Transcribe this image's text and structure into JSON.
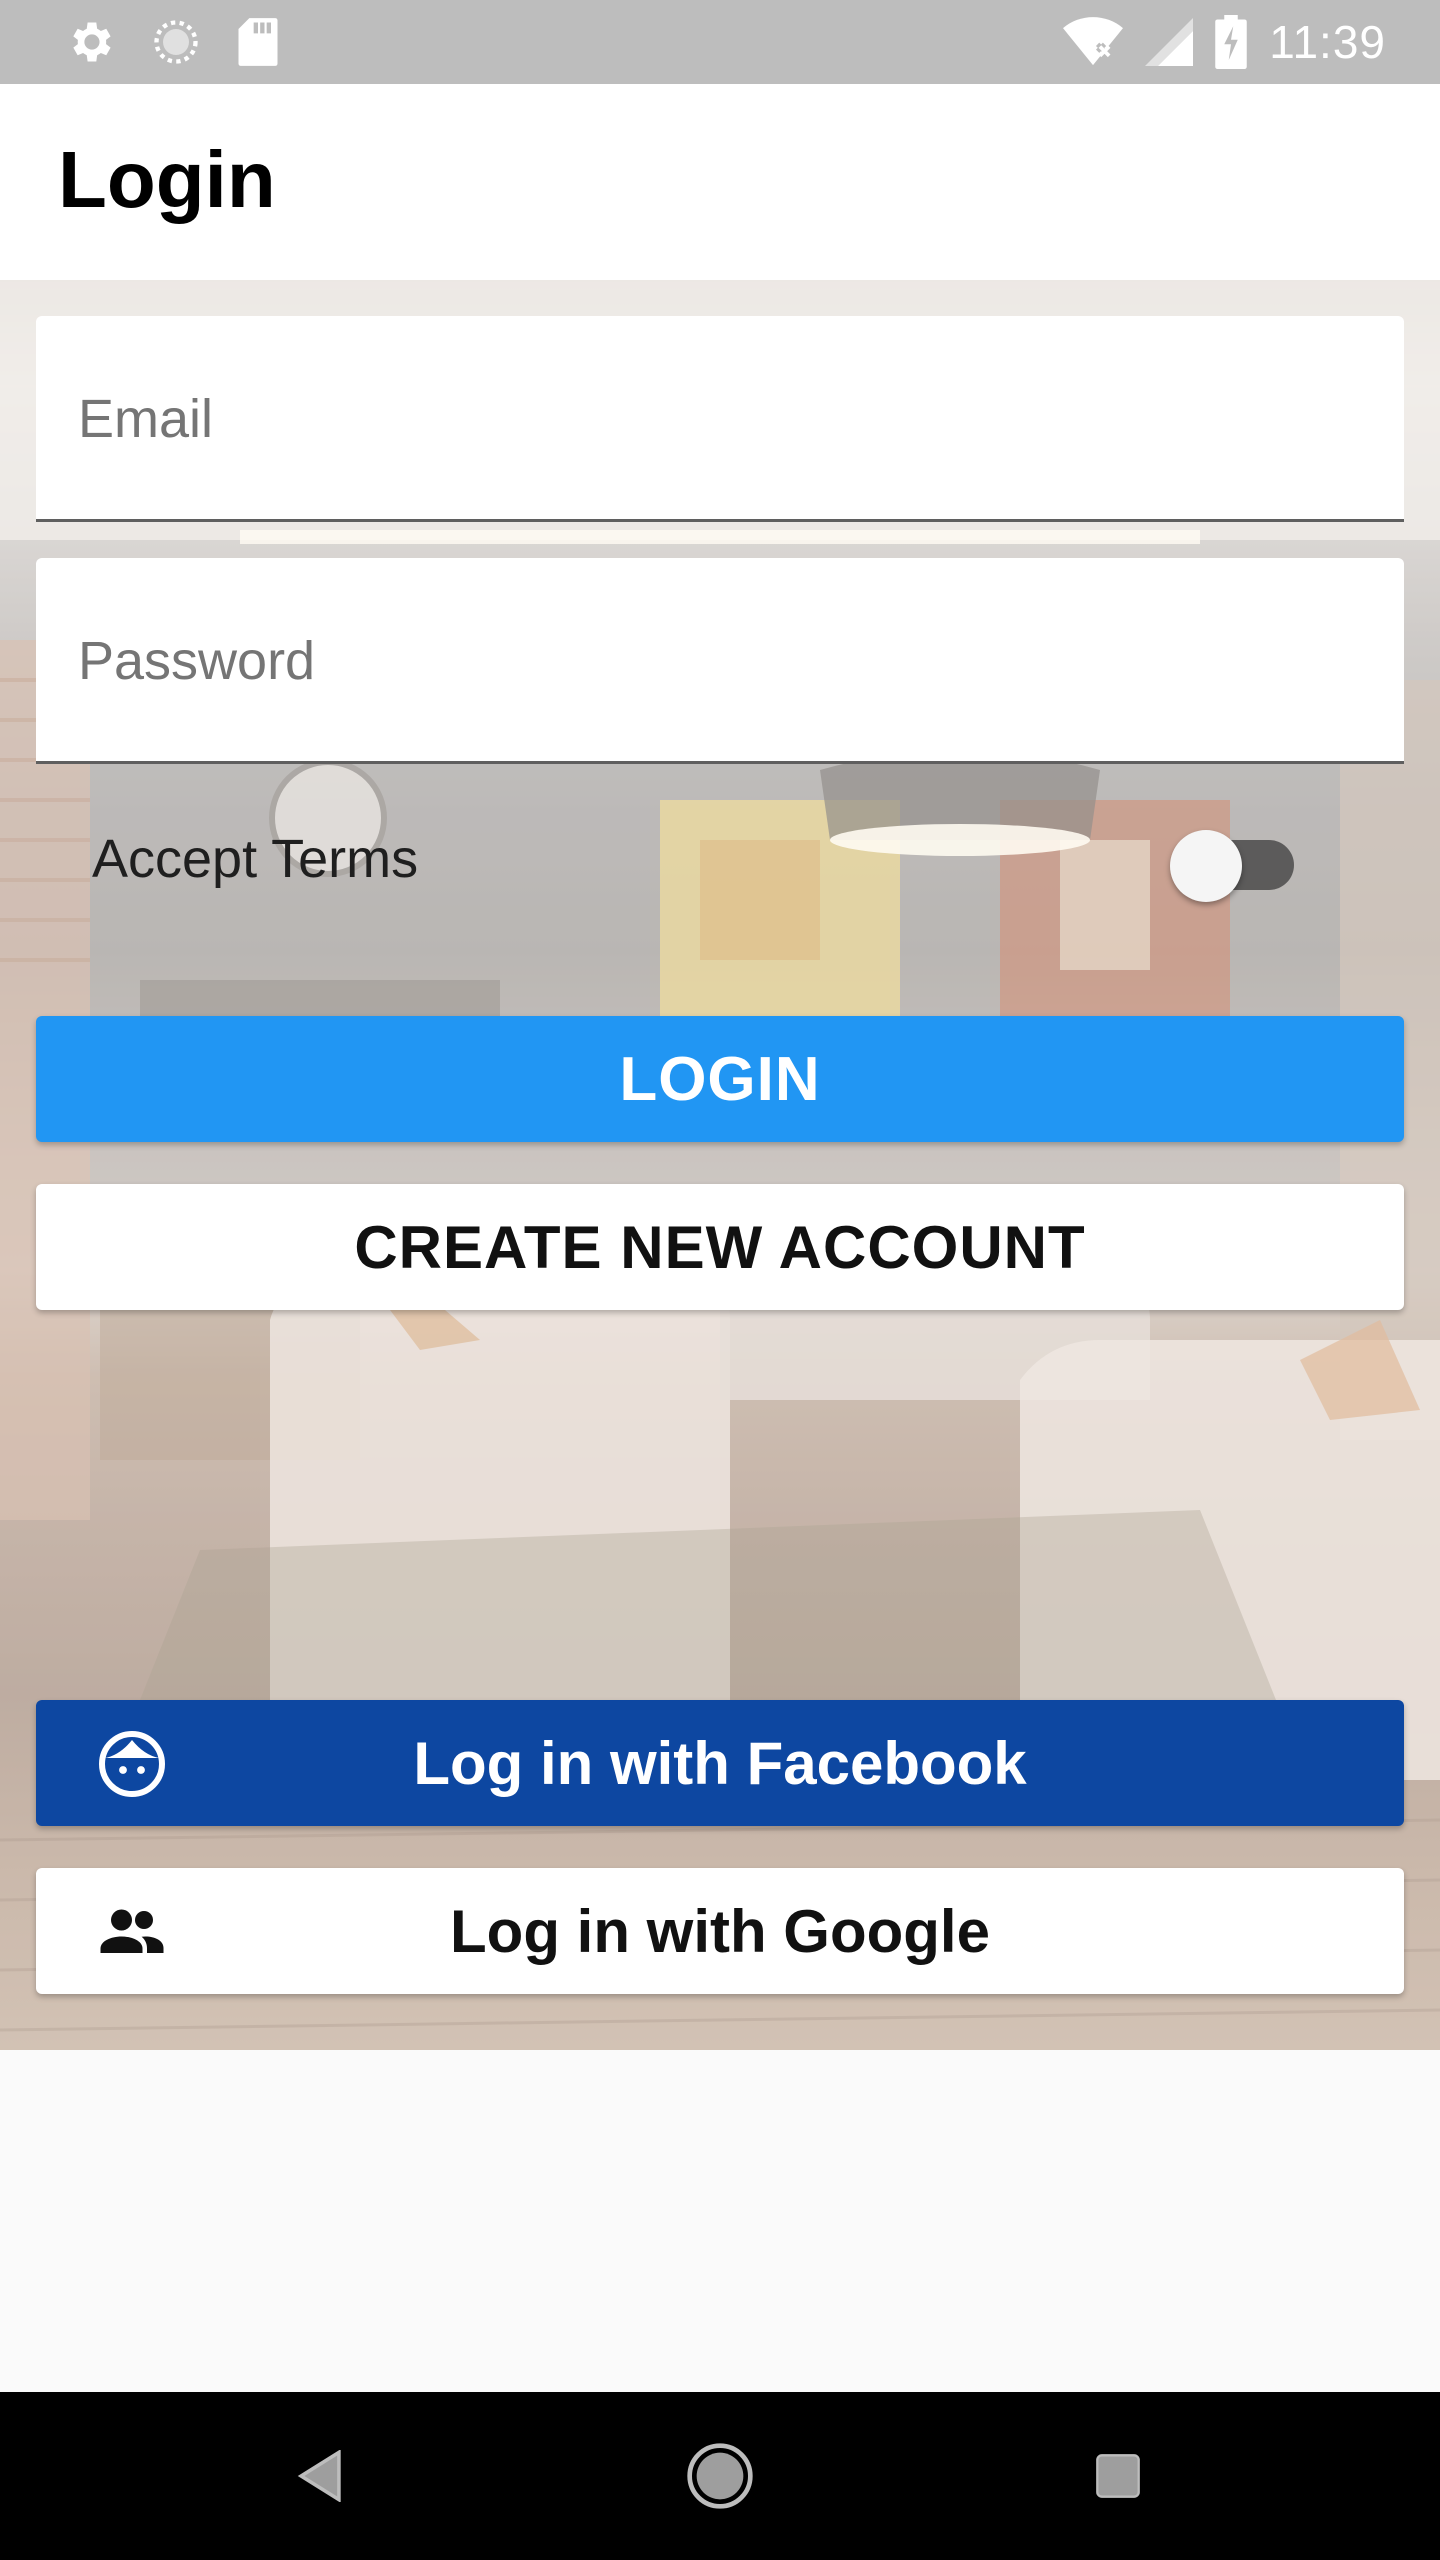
{
  "status_bar": {
    "time": "11:39",
    "left_icons": [
      "settings-icon",
      "sync-icon",
      "sd-card-icon"
    ],
    "right_icons": [
      "wifi-off-icon",
      "signal-icon",
      "battery-charging-icon"
    ],
    "background": "#bdbdbd"
  },
  "app_bar": {
    "title": "Login"
  },
  "form": {
    "email_placeholder": "Email",
    "email_value": "",
    "password_placeholder": "Password",
    "password_value": "",
    "terms_label": "Accept Terms",
    "terms_accepted": false
  },
  "buttons": {
    "login": "LOGIN",
    "create_account": "CREATE NEW ACCOUNT",
    "facebook": "Log in with Facebook",
    "google": "Log in with Google"
  },
  "icons": {
    "facebook_button_icon": "face-icon",
    "google_button_icon": "people-icon"
  },
  "colors": {
    "primary": "#2196f3",
    "facebook": "#0d47a1",
    "nav_bar": "#000000"
  },
  "nav_bar": {
    "items": [
      "back-icon",
      "home-icon",
      "recents-icon"
    ]
  }
}
